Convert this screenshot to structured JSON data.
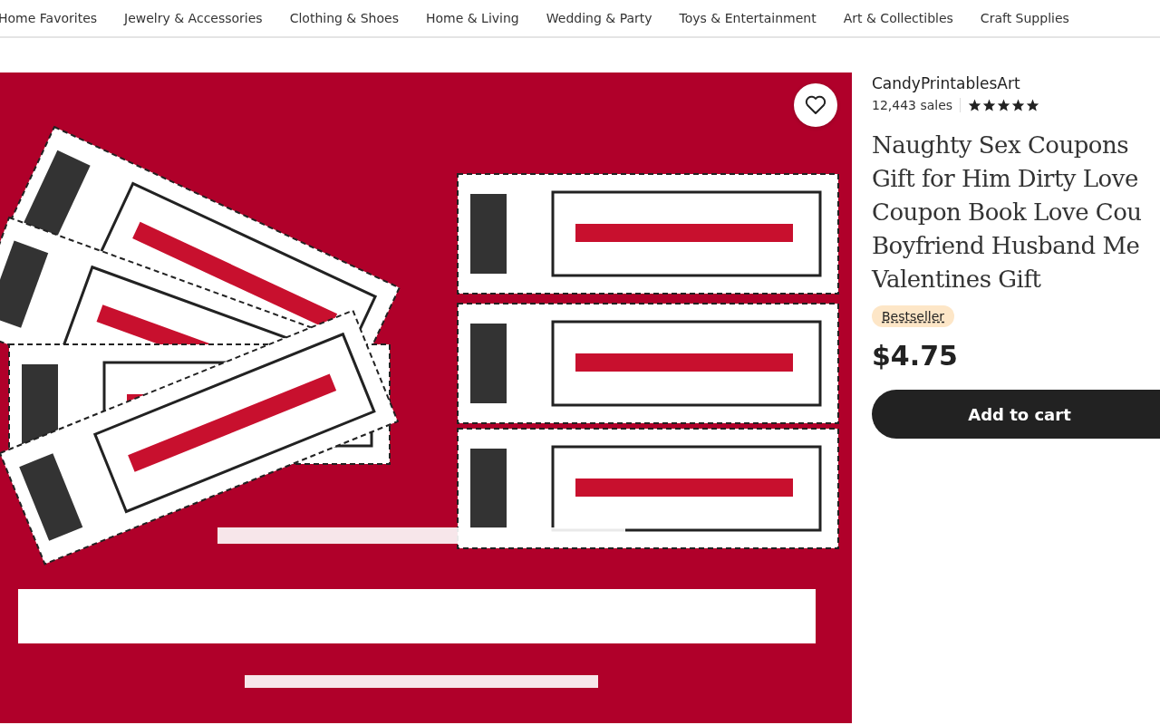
{
  "nav": {
    "items": [
      {
        "label": "Home Favorites",
        "selected": false
      },
      {
        "label": "Jewelry & Accessories",
        "selected": false
      },
      {
        "label": "Clothing & Shoes",
        "selected": false
      },
      {
        "label": "Home & Living",
        "selected": false
      },
      {
        "label": "Wedding & Party",
        "selected": false
      },
      {
        "label": "Toys & Entertainment",
        "selected": false
      },
      {
        "label": "Art & Collectibles",
        "selected": false
      },
      {
        "label": "Craft Supplies",
        "selected": false
      }
    ]
  },
  "listing": {
    "shop_name": "CandyPrintablesArt",
    "sales": "12,443 sales",
    "stars": 5,
    "title_lines": [
      "Naughty Sex Coupons",
      "Gift for Him Dirty Love",
      "Coupon Book Love Cou",
      "Boyfriend Husband Me",
      "Valentines Gift"
    ],
    "badge": "Bestseller",
    "price": "$4.75",
    "cart_button": "Add to cart"
  }
}
